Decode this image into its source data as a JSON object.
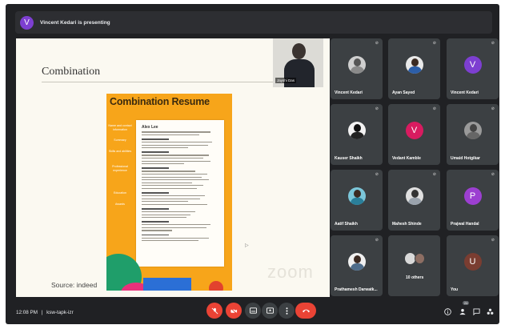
{
  "presenting_bar": {
    "avatar_letter": "V",
    "text": "Vincent Kedari is presenting",
    "avatar_color": "#7d3fd1"
  },
  "shared_screen": {
    "slide_title": "Combination",
    "speaker_name": "Jayshi Das",
    "resume_heading": "Combination Resume",
    "resume_person": "Alex Lee",
    "resume_sidebar": [
      "Name and contact information",
      "Summary",
      "Skills and abilities",
      "Professional experience",
      "Education",
      "Awards"
    ],
    "source": "Source: indeed",
    "watermark": "zoom"
  },
  "participants": [
    {
      "name": "Vincent Kedari",
      "kind": "photo",
      "photo_color": "#d8d8d8"
    },
    {
      "name": "Ayan Sayed",
      "kind": "photo",
      "photo_color": "#2c5ea8"
    },
    {
      "name": "Vincent Kedari",
      "kind": "letter",
      "letter": "V",
      "color": "#7d3fd1"
    },
    {
      "name": "Kauser Shaikh",
      "kind": "photo",
      "photo_color": "#eaeaea"
    },
    {
      "name": "Vedant Kamble",
      "kind": "letter",
      "letter": "V",
      "color": "#d81b60"
    },
    {
      "name": "Umaid Hotgikar",
      "kind": "photo",
      "photo_color": "#5a5a5a"
    },
    {
      "name": "Aatif Shaikh",
      "kind": "photo",
      "photo_color": "#2aa8c6"
    },
    {
      "name": "Mahesh Shinde",
      "kind": "photo",
      "photo_color": "#cfcfcf"
    },
    {
      "name": "Prajwal Handal",
      "kind": "letter",
      "letter": "P",
      "color": "#9c3fd1"
    },
    {
      "name": "Prathamesh Darwatk...",
      "kind": "photo",
      "photo_color": "#e7e7e7"
    },
    {
      "name": "10 others",
      "kind": "others"
    },
    {
      "name": "You",
      "kind": "letter",
      "letter": "U",
      "color": "#7a3d31"
    }
  ],
  "bottom_bar": {
    "time": "12:08 PM",
    "separator": "|",
    "meeting_code": "ksw-tapk-izr",
    "people_count": "24",
    "icons": {
      "mic": "mic-off-icon",
      "camera": "camera-off-icon",
      "captions": "captions-icon",
      "present": "present-screen-icon",
      "more": "more-options-icon",
      "end_call": "end-call-icon",
      "info": "info-icon",
      "people": "people-icon",
      "chat": "chat-icon",
      "activities": "activities-icon"
    },
    "danger_color": "#ea4335"
  }
}
